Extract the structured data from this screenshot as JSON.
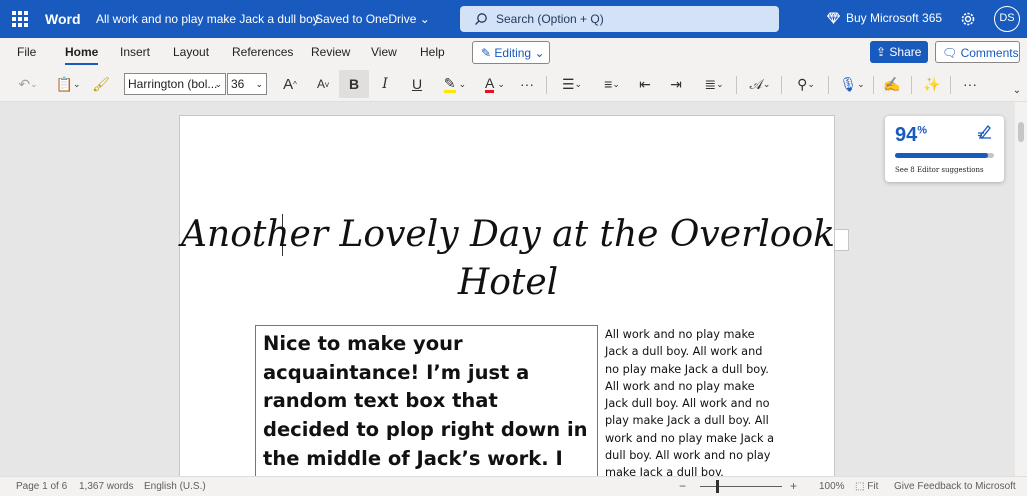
{
  "titlebar": {
    "app_name": "Word",
    "document_title": "All work and no play make Jack a dull boy",
    "save_status": "Saved to OneDrive",
    "search_placeholder": "Search (Option + Q)",
    "buy_label": "Buy Microsoft 365",
    "avatar_initials": "DS",
    "accent_color": "#185abd"
  },
  "menu": {
    "tabs": [
      "File",
      "Home",
      "Insert",
      "Layout",
      "References",
      "Review",
      "View",
      "Help"
    ],
    "active_tab": "Home",
    "editing_label": "Editing",
    "share_label": "Share",
    "comments_label": "Comments"
  },
  "ribbon": {
    "font_name": "Harrington (bol...",
    "font_size": "36",
    "grow_font": "A",
    "shrink_font": "A",
    "bold": "B",
    "italic": "I",
    "underline": "U",
    "font_color_letter": "A",
    "more": "···",
    "highlight_color": "#ffe800",
    "font_color": "#e81123"
  },
  "document": {
    "heading": "Another Lovely Day at the Overlook Hotel",
    "textbox": "Nice to make your acquaintance! I’m just a random text box that decided to plop right down in the middle of Jack’s work. I figured he could use a little excitement.",
    "body": "All work and no play make Jack a dull boy. All work and no play make Jack a dull boy. All work and no play make Jack dull boy. All work and no play make Jack a dull boy. All work and no play make Jack a dull boy. All work and no play make Jack a dull boy."
  },
  "editor": {
    "score": "94",
    "score_unit": "%",
    "score_fraction": 0.94,
    "suggestions_text": "See 8 Editor suggestions"
  },
  "statusbar": {
    "page_info": "Page 1 of 6",
    "word_count": "1,367 words",
    "language": "English (U.S.)",
    "zoom_minus": "−",
    "zoom_plus": "+",
    "zoom_level": "100%",
    "fit_label": "Fit",
    "feedback_label": "Give Feedback to Microsoft"
  }
}
